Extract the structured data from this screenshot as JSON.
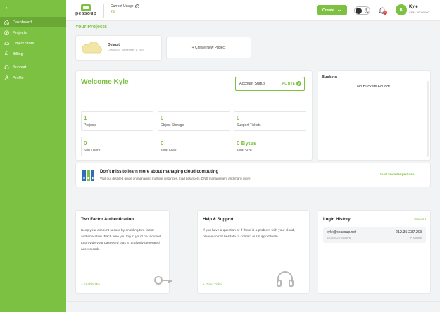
{
  "sidebar": {
    "items": [
      {
        "label": "Dashboard",
        "icon": "home-icon",
        "active": true
      },
      {
        "label": "Projects",
        "icon": "cube-icon"
      },
      {
        "label": "Object Store",
        "icon": "cloud-icon"
      },
      {
        "label": "Billing",
        "icon": "pound-icon"
      },
      {
        "label": "Support",
        "icon": "headset-icon"
      },
      {
        "label": "Profile",
        "icon": "user-icon"
      }
    ]
  },
  "header": {
    "logo_text": "peasoup",
    "usage_label": "Current Usage",
    "usage_value": "£0",
    "create_label": "Create",
    "notification_count": "1",
    "avatar_initial": "K",
    "user_name": "Kyle",
    "user_id": "CRN: 40000000"
  },
  "projects": {
    "section_title": "Your Projects",
    "default_name": "Default",
    "default_created": "Created 07 September 1, 2024",
    "new_project_label": "+ Create New Project"
  },
  "welcome": {
    "title": "Welcome Kyle",
    "account_status_label": "Account Status",
    "account_status_value": "ACTIVE",
    "stats": [
      {
        "value": "1",
        "label": "Projects"
      },
      {
        "value": "0",
        "label": "Object Storage"
      },
      {
        "value": "0",
        "label": "Support Tickets"
      },
      {
        "value": "0",
        "label": "Sub Users"
      },
      {
        "value": "0",
        "label": "Total Files"
      },
      {
        "value": "0 Bytes",
        "label": "Total Size"
      }
    ]
  },
  "buckets": {
    "title": "Buckets",
    "empty_text": "No Buckets Found!"
  },
  "knowledge": {
    "title": "Don't miss to learn more about managing cloud computing",
    "description": "Visit our detailed guide on managing multiple instances, load balancers, DNS management and many more.",
    "link": "Visit knowledge base"
  },
  "tfa": {
    "title": "Two Factor Authentication",
    "description": "Keep your account secure by enabling two-factor authentication. Each time you log in you'll be required to provide your password plus a randomly generated access code",
    "link": "+ Enable 2FA"
  },
  "help": {
    "title": "Help & Support",
    "description": "If you have a question or if there is a problem with your cloud, please do not hesitate to contact our support team",
    "link": "+ Open Ticket"
  },
  "login_history": {
    "title": "Login History",
    "view_all": "View All",
    "rows": [
      {
        "email": "kyle@peasoup.net",
        "time": "11/10/2024 04:53PM",
        "ip": "212.35.237.208",
        "ip_label": "IP Address"
      }
    ]
  },
  "colors": {
    "brand": "#7dc142",
    "sidebar": "#7dc142",
    "sidebar_active": "#6aa835",
    "badge": "#e53935"
  }
}
